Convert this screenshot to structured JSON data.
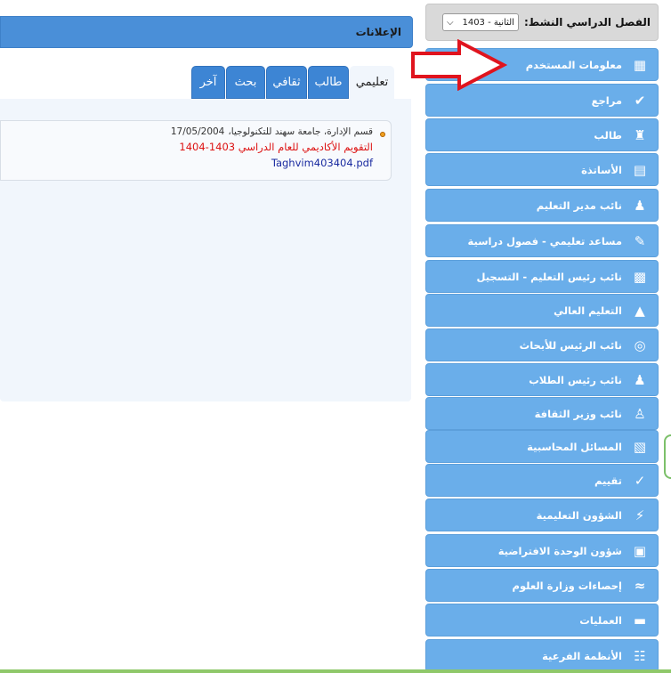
{
  "semester": {
    "label": "الفصل الدراسي النشط:",
    "selected": "الثانية - 1403"
  },
  "menu": [
    {
      "label": "معلومات المستخدم",
      "icon": "id-card-icon"
    },
    {
      "label": "مراجع",
      "icon": "check-icon"
    },
    {
      "label": "طالب",
      "icon": "student-icon"
    },
    {
      "label": "الأساتذة",
      "icon": "teacher-board-icon"
    },
    {
      "label": "نائب مدير التعليم",
      "icon": "officer-icon"
    },
    {
      "label": "مساعد تعليمي - فصول دراسية",
      "icon": "pencil-icon"
    },
    {
      "label": "نائب رئيس التعليم - التسجيل",
      "icon": "registration-card-icon"
    },
    {
      "label": "التعليم العالي",
      "icon": "graduation-cap-icon"
    },
    {
      "label": "نائب الرئيس للأبحاث",
      "icon": "research-book-icon"
    },
    {
      "label": "نائب رئيس الطلاب",
      "icon": "user-tie-icon"
    },
    {
      "label": "نائب وزير الثقافة",
      "icon": "people-icon"
    },
    {
      "label": "المسائل المحاسبية",
      "icon": "accounting-icon"
    },
    {
      "label": "تقييم",
      "icon": "check-outline-icon"
    },
    {
      "label": "الشؤون التعليمية",
      "icon": "lightning-icon"
    },
    {
      "label": "شؤون الوحدة الافتراضية",
      "icon": "monitor-icon"
    },
    {
      "label": "إحصاءات وزارة العلوم",
      "icon": "chart-line-icon"
    },
    {
      "label": "العمليات",
      "icon": "folder-open-icon"
    },
    {
      "label": "الأنظمة الفرعية",
      "icon": "sitemap-icon"
    }
  ],
  "announcements": {
    "title": "الإعلانات",
    "tabs": [
      {
        "label": "تعليمي",
        "active": true
      },
      {
        "label": "طالب",
        "active": false
      },
      {
        "label": "ثقافي",
        "active": false
      },
      {
        "label": "بحث",
        "active": false
      },
      {
        "label": "آخر",
        "active": false
      }
    ],
    "items": [
      {
        "source": "قسم الإدارة، جامعة سهند للتكنولوجيا،",
        "date": "17/05/2004",
        "title": "التقويم الأكاديمي للعام الدراسي 1403-1404",
        "file": "Taghvim403404.pdf"
      }
    ]
  },
  "colors": {
    "menu_bg": "#6aaeea",
    "header_bg": "#4a8fd8",
    "tab_bg": "#3d85d4",
    "panel_bg": "#f1f6fc",
    "arrow": "#e0141e",
    "title_red": "#dd1111",
    "link_blue": "#1a2ba0"
  }
}
